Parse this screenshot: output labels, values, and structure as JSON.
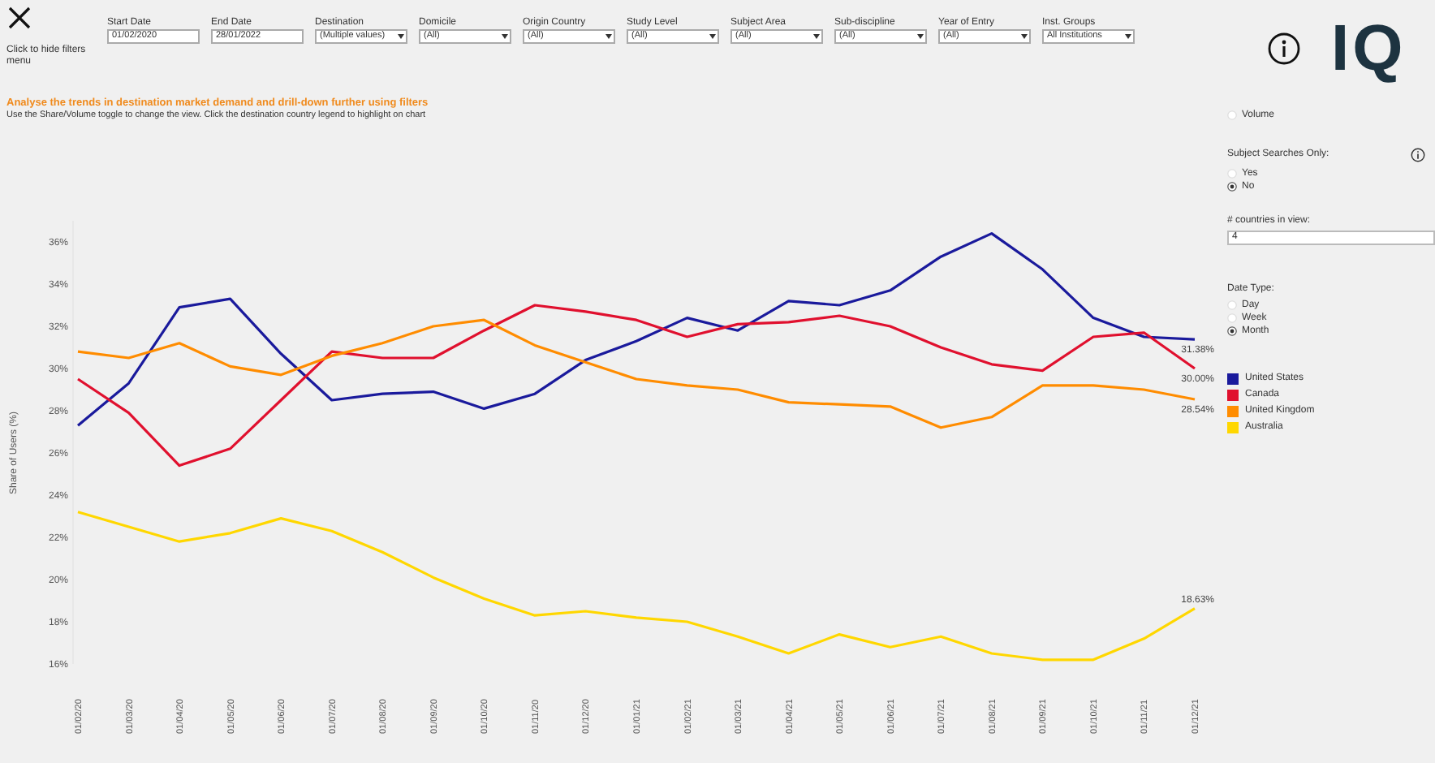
{
  "header": {
    "hide_filters_label": "Click to hide filters menu"
  },
  "filters": [
    {
      "label": "Start Date",
      "value": "01/02/2020",
      "kind": "date"
    },
    {
      "label": "End Date",
      "value": "28/01/2022",
      "kind": "date"
    },
    {
      "label": "Destination",
      "value": "(Multiple values)",
      "kind": "dropdown"
    },
    {
      "label": "Domicile",
      "value": "(All)",
      "kind": "dropdown"
    },
    {
      "label": "Origin Country",
      "value": "(All)",
      "kind": "dropdown"
    },
    {
      "label": "Study Level",
      "value": "(All)",
      "kind": "dropdown"
    },
    {
      "label": "Subject Area",
      "value": "(All)",
      "kind": "dropdown"
    },
    {
      "label": "Sub-discipline",
      "value": "(All)",
      "kind": "dropdown"
    },
    {
      "label": "Year of Entry",
      "value": "(All)",
      "kind": "dropdown"
    },
    {
      "label": "Inst. Groups",
      "value": "All Institutions",
      "kind": "dropdown"
    }
  ],
  "intro": {
    "headline": "Analyse the trends in destination market demand and drill-down further using filters",
    "instructions": "Use the Share/Volume toggle to change the view. Click the destination country legend to highlight on chart"
  },
  "logo": {
    "text": "IQ"
  },
  "measure_toggle": {
    "options": [
      {
        "label": "Volume",
        "selected": false
      }
    ]
  },
  "subject_searches": {
    "label": "Subject Searches Only:",
    "options": [
      {
        "label": "Yes",
        "selected": false
      },
      {
        "label": "No",
        "selected": true
      }
    ]
  },
  "countries_in_view": {
    "label": "# countries in view:",
    "value": "4"
  },
  "date_type": {
    "label": "Date Type:",
    "options": [
      {
        "label": "Day",
        "selected": false
      },
      {
        "label": "Week",
        "selected": false
      },
      {
        "label": "Month",
        "selected": true
      }
    ]
  },
  "chart_end_labels": [
    {
      "text": "31.38%"
    },
    {
      "text": "30.00%"
    },
    {
      "text": "28.54%"
    },
    {
      "text": "18.63%"
    }
  ],
  "chart_data": {
    "type": "line",
    "ylabel": "Share of Users (%)",
    "categories": [
      "01/02/20",
      "01/03/20",
      "01/04/20",
      "01/05/20",
      "01/06/20",
      "01/07/20",
      "01/08/20",
      "01/09/20",
      "01/10/20",
      "01/11/20",
      "01/12/20",
      "01/01/21",
      "01/02/21",
      "01/03/21",
      "01/04/21",
      "01/05/21",
      "01/06/21",
      "01/07/21",
      "01/08/21",
      "01/09/21",
      "01/10/21",
      "01/11/21",
      "01/12/21"
    ],
    "ylim": [
      16,
      37
    ],
    "yticks": [
      {
        "value": 16,
        "label": "16%"
      },
      {
        "value": 18,
        "label": "18%"
      },
      {
        "value": 20,
        "label": "20%"
      },
      {
        "value": 22,
        "label": "22%"
      },
      {
        "value": 24,
        "label": "24%"
      },
      {
        "value": 26,
        "label": "26%"
      },
      {
        "value": 28,
        "label": "28%"
      },
      {
        "value": 30,
        "label": "30%"
      },
      {
        "value": 32,
        "label": "32%"
      },
      {
        "value": 34,
        "label": "34%"
      },
      {
        "value": 36,
        "label": "36%"
      }
    ],
    "series": [
      {
        "name": "United States",
        "color": "#1a1a9c",
        "values": [
          27.3,
          29.3,
          32.9,
          33.3,
          30.7,
          28.5,
          28.8,
          28.9,
          28.1,
          28.8,
          30.4,
          31.3,
          32.4,
          31.8,
          33.2,
          33.0,
          33.7,
          35.3,
          36.4,
          34.7,
          32.4,
          31.5,
          31.38
        ]
      },
      {
        "name": "Canada",
        "color": "#e0102e",
        "values": [
          29.5,
          27.9,
          25.4,
          26.2,
          28.5,
          30.8,
          30.5,
          30.5,
          31.8,
          33.0,
          32.7,
          32.3,
          31.5,
          32.1,
          32.2,
          32.5,
          32.0,
          31.0,
          30.2,
          29.9,
          31.5,
          31.7,
          30.0
        ]
      },
      {
        "name": "United Kingdom",
        "color": "#ff8c00",
        "values": [
          30.8,
          30.5,
          31.2,
          30.1,
          29.7,
          30.6,
          31.2,
          32.0,
          32.3,
          31.1,
          30.3,
          29.5,
          29.2,
          29.0,
          28.4,
          28.3,
          28.2,
          27.2,
          27.7,
          29.2,
          29.2,
          29.0,
          28.54
        ]
      },
      {
        "name": "Australia",
        "color": "#ffd700",
        "values": [
          23.2,
          22.5,
          21.8,
          22.2,
          22.9,
          22.3,
          21.3,
          20.1,
          19.1,
          18.3,
          18.5,
          18.2,
          18.0,
          17.3,
          16.5,
          17.4,
          16.8,
          17.3,
          16.5,
          16.2,
          16.2,
          17.2,
          18.63
        ]
      }
    ]
  }
}
